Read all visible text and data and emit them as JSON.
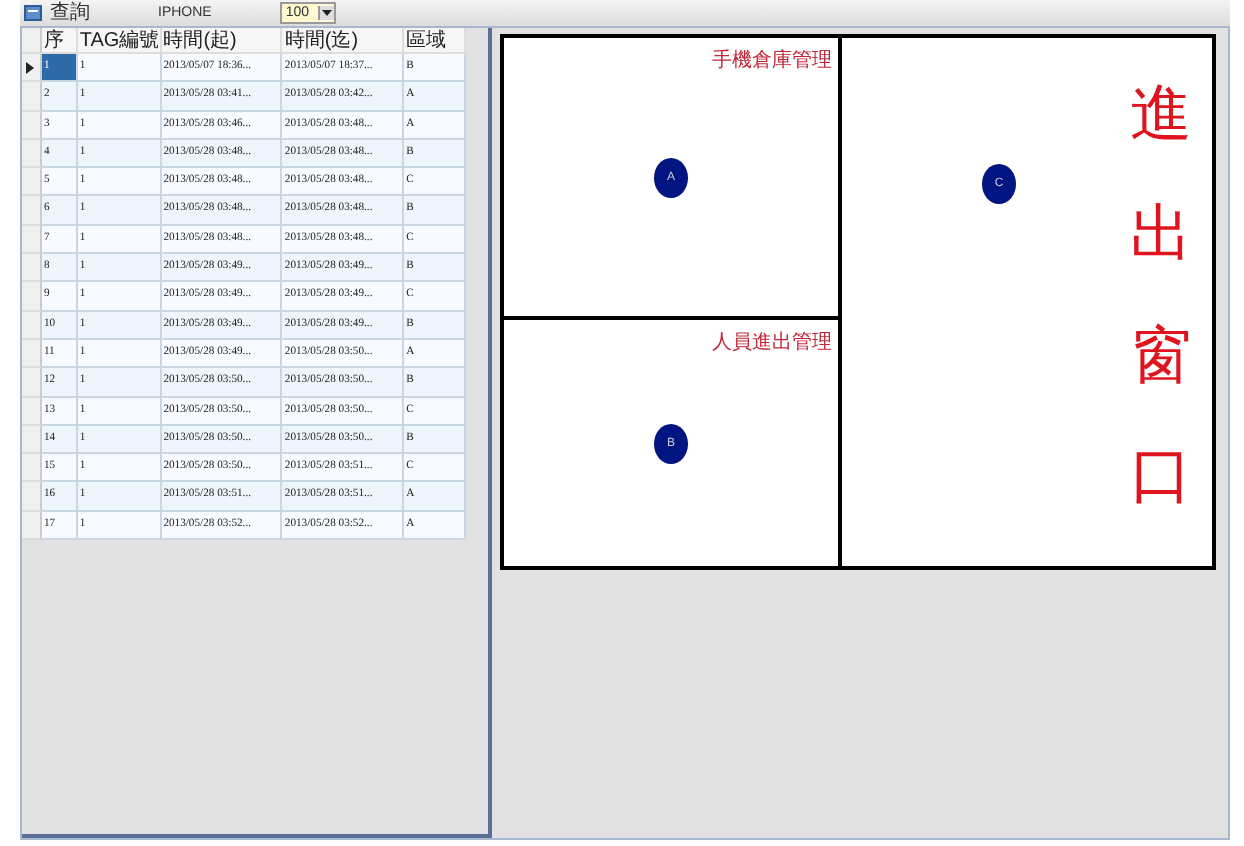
{
  "toolbar": {
    "label": "查詢",
    "device": "IPHONE",
    "count": "100"
  },
  "table": {
    "columns": [
      "序",
      "TAG編號",
      "時間(起)",
      "時間(迄)",
      "區域"
    ],
    "rows": [
      {
        "selected": true,
        "cells": [
          "1",
          "1",
          "2013/05/07 18:36...",
          "2013/05/07 18:37...",
          "B"
        ]
      },
      {
        "selected": false,
        "cells": [
          "2",
          "1",
          "2013/05/28 03:41...",
          "2013/05/28 03:42...",
          "A"
        ]
      },
      {
        "selected": false,
        "cells": [
          "3",
          "1",
          "2013/05/28 03:46...",
          "2013/05/28 03:48...",
          "A"
        ]
      },
      {
        "selected": false,
        "cells": [
          "4",
          "1",
          "2013/05/28 03:48...",
          "2013/05/28 03:48...",
          "B"
        ]
      },
      {
        "selected": false,
        "cells": [
          "5",
          "1",
          "2013/05/28 03:48...",
          "2013/05/28 03:48...",
          "C"
        ]
      },
      {
        "selected": false,
        "cells": [
          "6",
          "1",
          "2013/05/28 03:48...",
          "2013/05/28 03:48...",
          "B"
        ]
      },
      {
        "selected": false,
        "cells": [
          "7",
          "1",
          "2013/05/28 03:48...",
          "2013/05/28 03:48...",
          "C"
        ]
      },
      {
        "selected": false,
        "cells": [
          "8",
          "1",
          "2013/05/28 03:49...",
          "2013/05/28 03:49...",
          "B"
        ]
      },
      {
        "selected": false,
        "cells": [
          "9",
          "1",
          "2013/05/28 03:49...",
          "2013/05/28 03:49...",
          "C"
        ]
      },
      {
        "selected": false,
        "cells": [
          "10",
          "1",
          "2013/05/28 03:49...",
          "2013/05/28 03:49...",
          "B"
        ]
      },
      {
        "selected": false,
        "cells": [
          "11",
          "1",
          "2013/05/28 03:49...",
          "2013/05/28 03:50...",
          "A"
        ]
      },
      {
        "selected": false,
        "cells": [
          "12",
          "1",
          "2013/05/28 03:50...",
          "2013/05/28 03:50...",
          "B"
        ]
      },
      {
        "selected": false,
        "cells": [
          "13",
          "1",
          "2013/05/28 03:50...",
          "2013/05/28 03:50...",
          "C"
        ]
      },
      {
        "selected": false,
        "cells": [
          "14",
          "1",
          "2013/05/28 03:50...",
          "2013/05/28 03:50...",
          "B"
        ]
      },
      {
        "selected": false,
        "cells": [
          "15",
          "1",
          "2013/05/28 03:50...",
          "2013/05/28 03:51...",
          "C"
        ]
      },
      {
        "selected": false,
        "cells": [
          "16",
          "1",
          "2013/05/28 03:51...",
          "2013/05/28 03:51...",
          "A"
        ]
      },
      {
        "selected": false,
        "cells": [
          "17",
          "1",
          "2013/05/28 03:52...",
          "2013/05/28 03:52...",
          "A"
        ]
      }
    ]
  },
  "zones": [
    {
      "kind": "area",
      "label": "手機倉庫管理",
      "marker": "A"
    },
    {
      "kind": "area",
      "label": "人員進出管理",
      "marker": "B"
    },
    {
      "kind": "gate",
      "label": "進出窗口",
      "marker": "C"
    }
  ]
}
